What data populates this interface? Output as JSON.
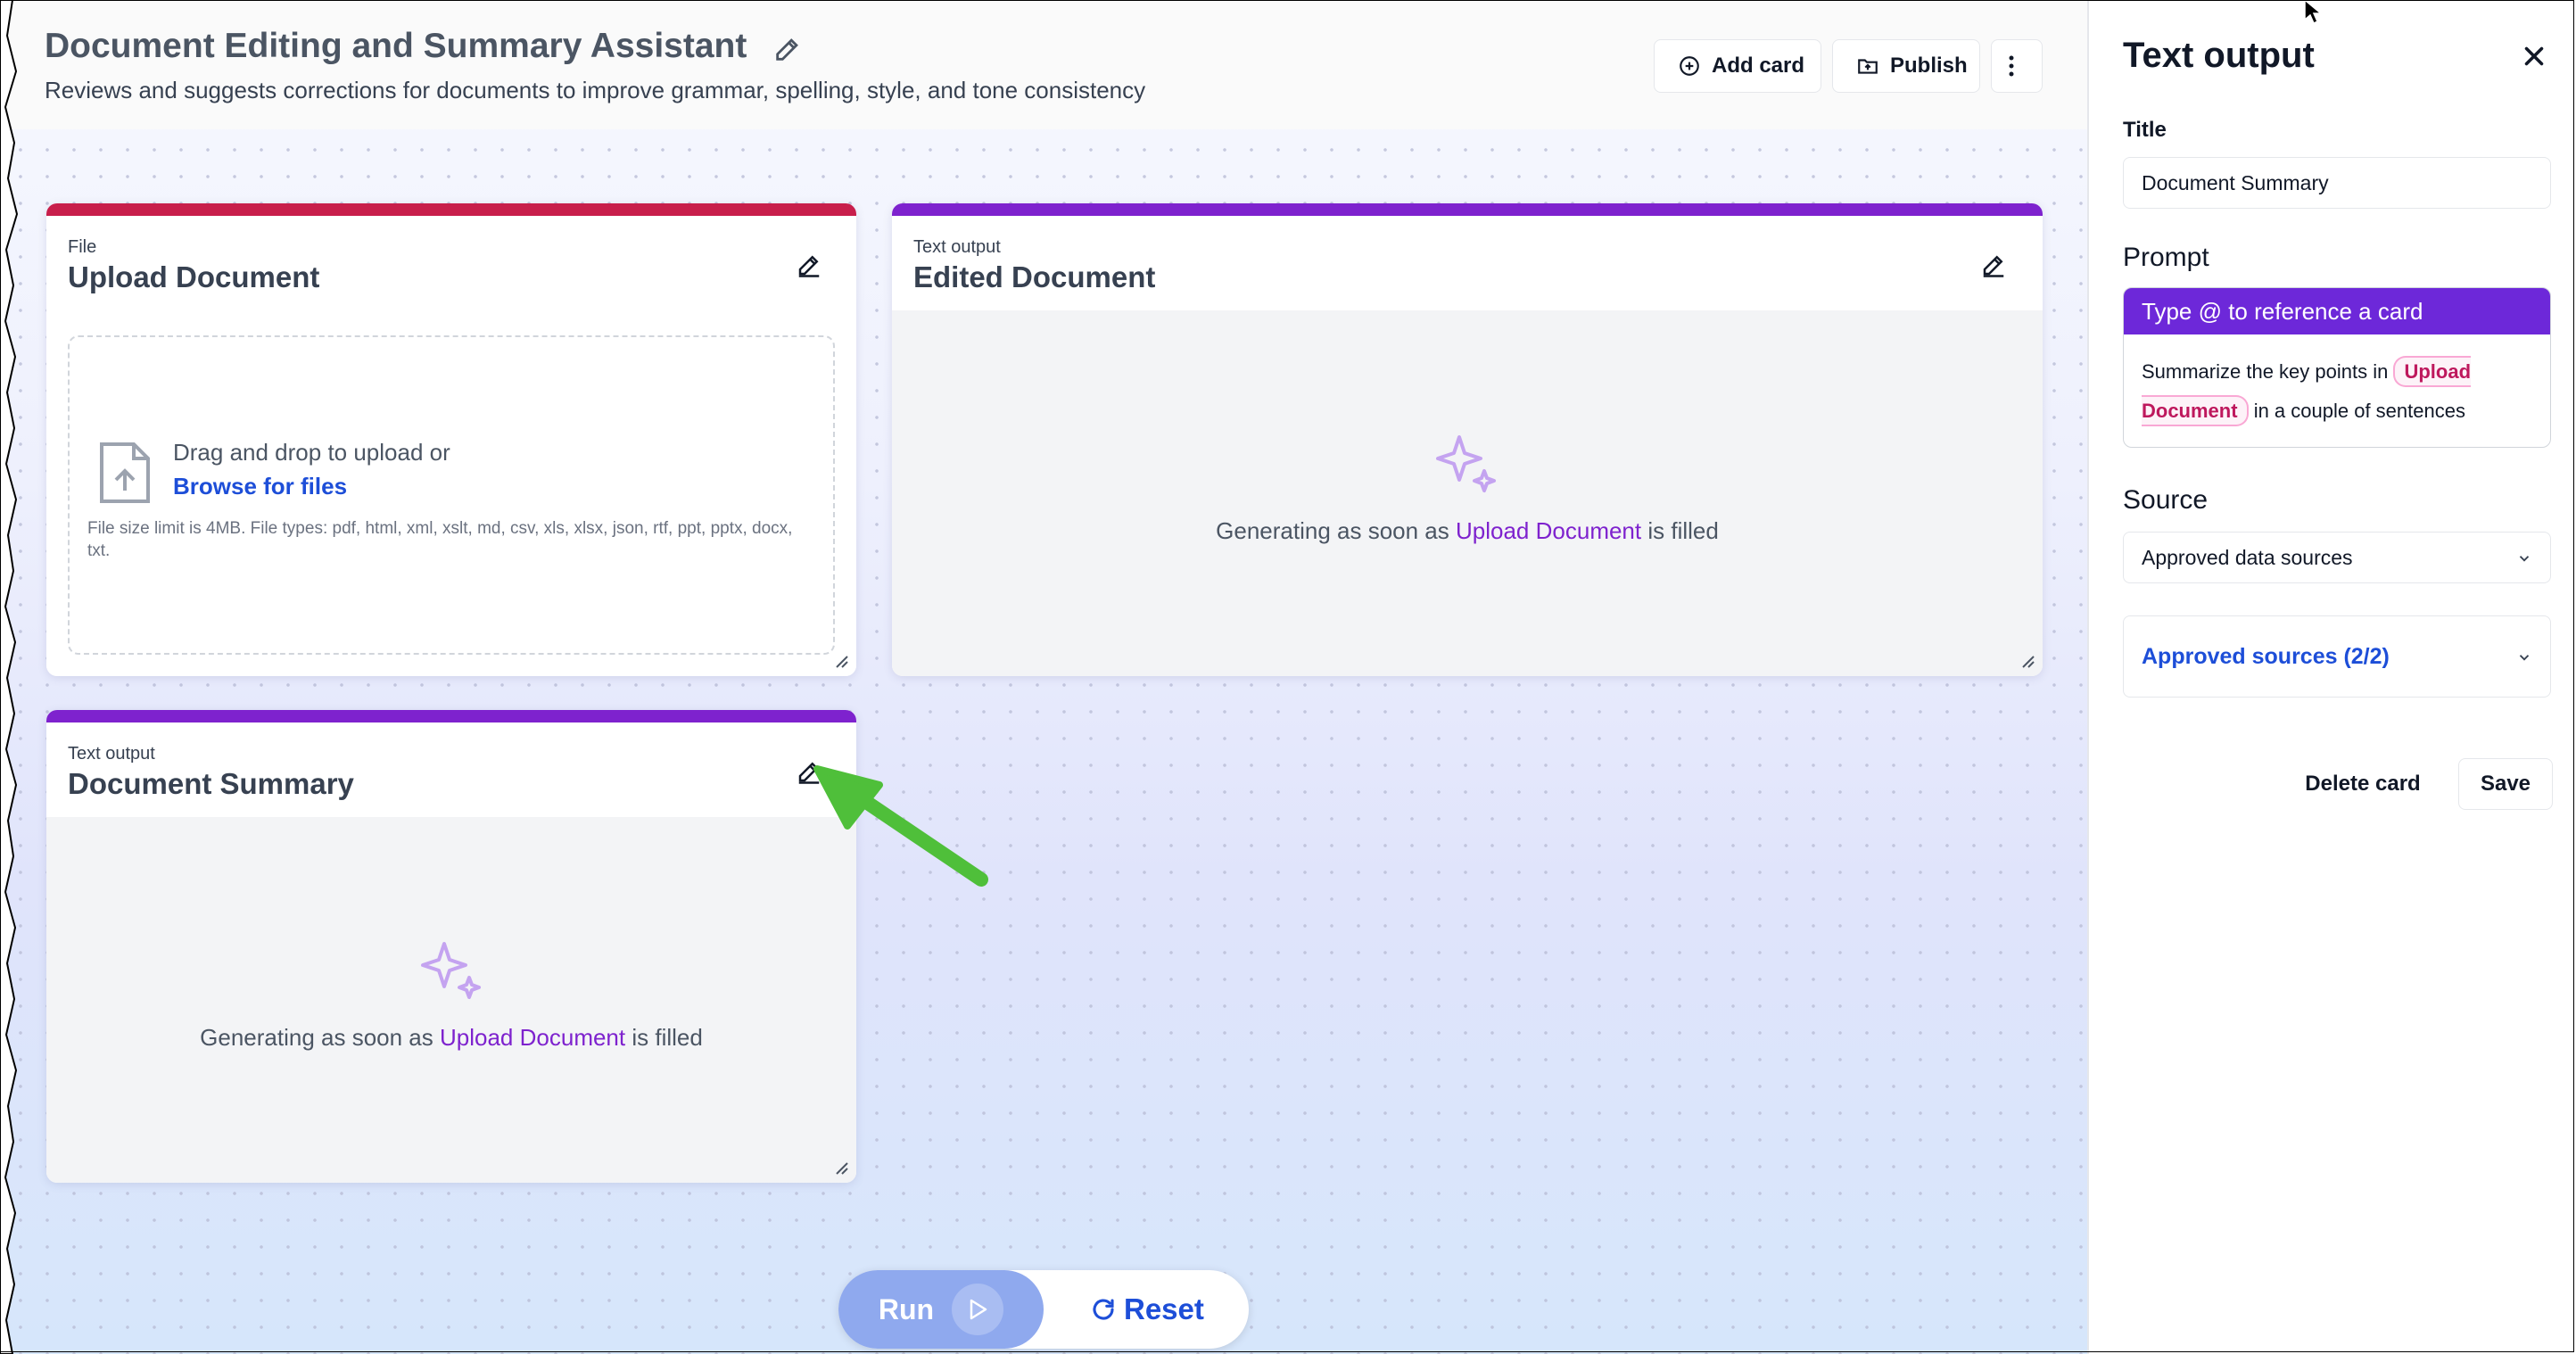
{
  "header": {
    "title": "Document Editing and Summary Assistant",
    "description": "Reviews and suggests corrections for documents to improve grammar, spelling, style, and tone consistency",
    "add_card_label": "Add card",
    "publish_label": "Publish"
  },
  "cards": [
    {
      "type": "File",
      "name": "Upload Document",
      "color": "#c81e4b",
      "upload": {
        "drag_text": "Drag and drop to upload or",
        "browse_text": "Browse for files",
        "limits": "File size limit is 4MB. File types: pdf, html, xml, xslt, md, csv, xls, xlsx, json, rtf, ppt, pptx, docx, txt."
      }
    },
    {
      "type": "Text output",
      "name": "Edited Document",
      "color": "#7e22ce",
      "msg_prefix": "Generating as soon as",
      "msg_ref": "Upload Document",
      "msg_suffix": "is filled"
    },
    {
      "type": "Text output",
      "name": "Document Summary",
      "color": "#7e22ce",
      "msg_prefix": "Generating as soon as",
      "msg_ref": "Upload Document",
      "msg_suffix": "is filled"
    }
  ],
  "controls": {
    "run_label": "Run",
    "reset_label": "Reset"
  },
  "panel": {
    "title": "Text output",
    "title_label": "Title",
    "title_value": "Document Summary",
    "prompt_label": "Prompt",
    "prompt_hint": "Type @ to reference a card",
    "prompt_text_1": "Summarize the key points in",
    "prompt_chip": "Upload Document",
    "prompt_text_2": "in a couple of sentences",
    "source_label": "Source",
    "source_value": "Approved data sources",
    "approved_sources": "Approved sources (2/2)",
    "delete_label": "Delete card",
    "save_label": "Save"
  },
  "colors": {
    "accent_purple": "#7e22ce",
    "accent_red": "#c81e4b",
    "link_blue": "#1d4ed8",
    "annotation_green": "#4fbf3a"
  }
}
